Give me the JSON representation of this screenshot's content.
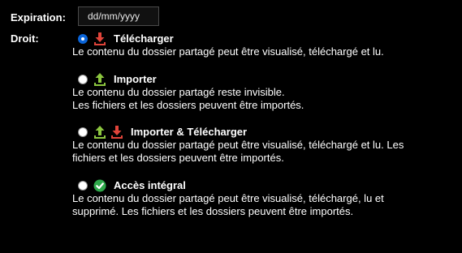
{
  "expiration": {
    "label": "Expiration:",
    "placeholder": "dd/mm/yyyy"
  },
  "droit": {
    "label": "Droit:",
    "options": [
      {
        "title": "Télécharger",
        "description": "Le contenu du dossier partagé peut être visualisé, téléchargé et lu.",
        "selected": true,
        "icons": [
          "download-icon"
        ]
      },
      {
        "title": "Importer",
        "description": "Le contenu du dossier partagé reste invisible.\nLes fichiers et les dossiers peuvent être importés.",
        "selected": false,
        "icons": [
          "upload-icon"
        ]
      },
      {
        "title": "Importer & Télécharger",
        "description": "Le contenu du dossier partagé peut être visualisé, téléchargé et lu. Les\nfichiers et les dossiers peuvent être importés.",
        "selected": false,
        "icons": [
          "upload-icon",
          "download-icon"
        ]
      },
      {
        "title": "Accès intégral",
        "description": "Le contenu du dossier partagé peut être visualisé, téléchargé, lu et\nsupprimé. Les fichiers et les dossiers peuvent être importés.",
        "selected": false,
        "icons": [
          "check-circle-icon"
        ]
      }
    ]
  },
  "colors": {
    "background": "#000000",
    "text": "#ffffff",
    "download_icon": "#e0443a",
    "upload_icon": "#8cc63f",
    "check_icon": "#2ea84a",
    "radio_selected": "#0a64d8"
  }
}
